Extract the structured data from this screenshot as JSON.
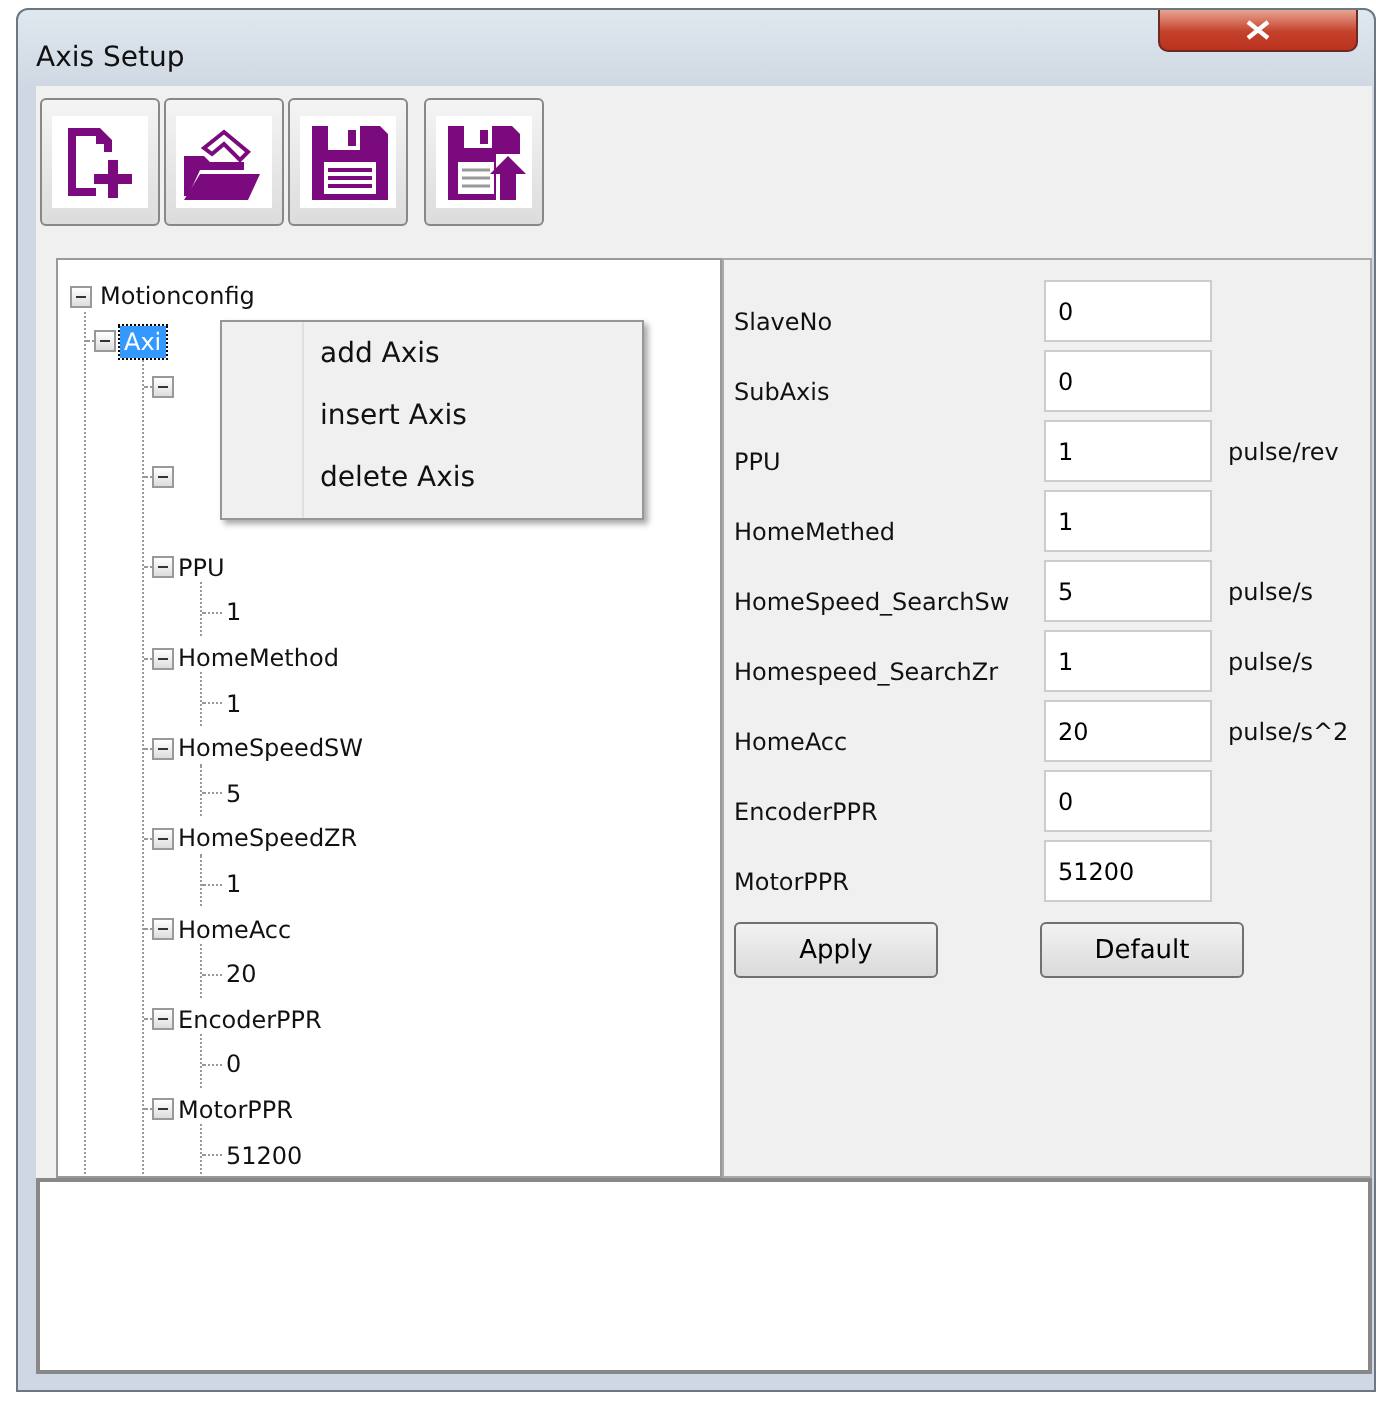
{
  "window": {
    "title": "Axis Setup"
  },
  "toolbar": [
    {
      "kind": "new"
    },
    {
      "kind": "open"
    },
    {
      "kind": "save"
    },
    {
      "kind": "export"
    }
  ],
  "tree": [
    {
      "label": "Motionconfig",
      "expanded": true,
      "selected": false,
      "children": [
        {
          "label": "Axi",
          "expanded": true,
          "selected": true,
          "children": [
            {
              "expanded": true
            },
            {
              "expanded": true
            },
            {
              "label": "PPU",
              "expanded": true,
              "selected": false,
              "children": [
                {
                  "label": "1",
                  "selected": false
                }
              ]
            },
            {
              "label": "HomeMethod",
              "expanded": true,
              "selected": false,
              "children": [
                {
                  "label": "1",
                  "selected": false
                }
              ]
            },
            {
              "label": "HomeSpeedSW",
              "expanded": true,
              "selected": false,
              "children": [
                {
                  "label": "5",
                  "selected": false
                }
              ]
            },
            {
              "label": "HomeSpeedZR",
              "expanded": true,
              "selected": false,
              "children": [
                {
                  "label": "1",
                  "selected": false
                }
              ]
            },
            {
              "label": "HomeAcc",
              "expanded": true,
              "selected": false,
              "children": [
                {
                  "label": "20",
                  "selected": false
                }
              ]
            },
            {
              "label": "EncoderPPR",
              "expanded": true,
              "selected": false,
              "children": [
                {
                  "label": "0",
                  "selected": false
                }
              ]
            },
            {
              "label": "MotorPPR",
              "expanded": true,
              "selected": false,
              "children": [
                {
                  "label": "51200",
                  "selected": false
                }
              ]
            }
          ]
        }
      ]
    }
  ],
  "context_menu": [
    "add Axis",
    "insert Axis",
    "delete Axis"
  ],
  "form": [
    {
      "label": "SlaveNo",
      "value": "0"
    },
    {
      "label": "SubAxis",
      "value": "0"
    },
    {
      "label": "PPU",
      "value": "1",
      "unit": "pulse/rev"
    },
    {
      "label": "HomeMethed",
      "value": "1"
    },
    {
      "label": "HomeSpeed_SearchSw",
      "value": "5",
      "unit": "pulse/s"
    },
    {
      "label": "Homespeed_SearchZr",
      "value": "1",
      "unit": "pulse/s"
    },
    {
      "label": "HomeAcc",
      "value": "20",
      "unit": "pulse/s^2"
    },
    {
      "label": "EncoderPPR",
      "value": "0"
    },
    {
      "label": "MotorPPR",
      "value": "51200"
    }
  ],
  "buttons": [
    "Apply",
    "Default"
  ]
}
